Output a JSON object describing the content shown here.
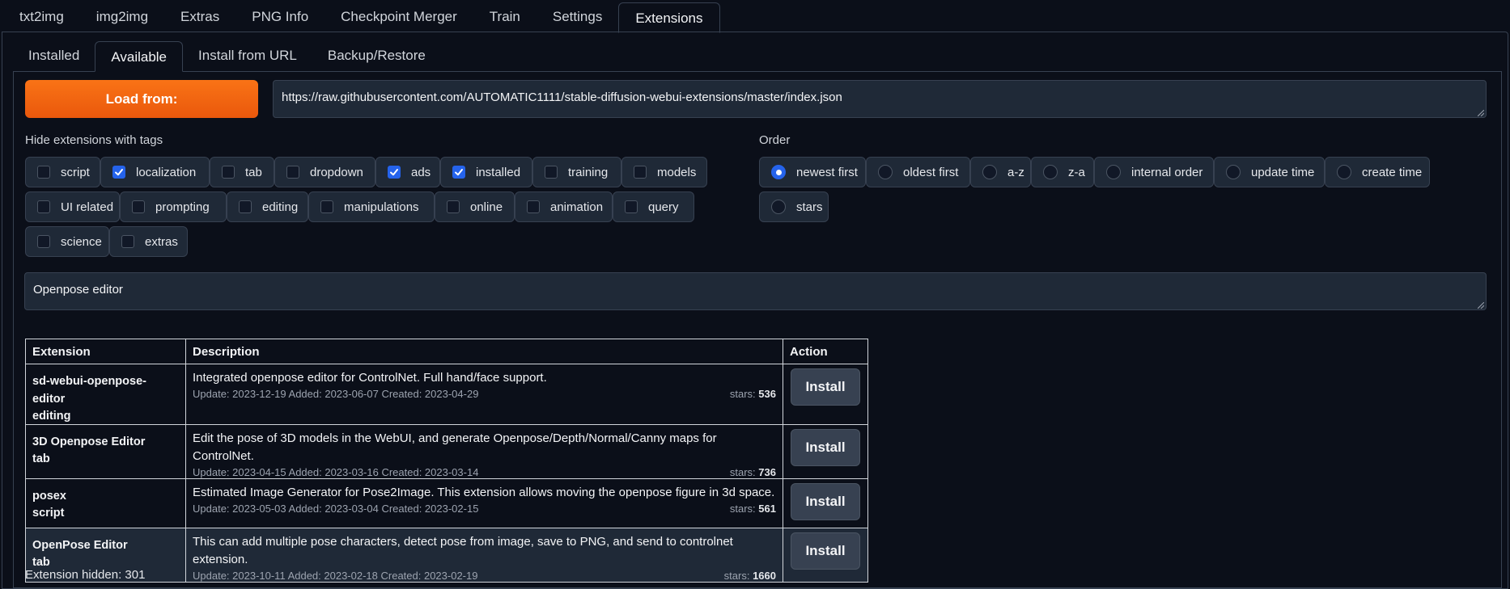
{
  "top_tabs": [
    "txt2img",
    "img2img",
    "Extras",
    "PNG Info",
    "Checkpoint Merger",
    "Train",
    "Settings",
    "Extensions"
  ],
  "top_tab_active": "Extensions",
  "sub_tabs": [
    "Installed",
    "Available",
    "Install from URL",
    "Backup/Restore"
  ],
  "sub_tab_active": "Available",
  "load_button": "Load from:",
  "url_value": "https://raw.githubusercontent.com/AUTOMATIC1111/stable-diffusion-webui-extensions/master/index.json",
  "hide_tags_label": "Hide extensions with tags",
  "tags": [
    {
      "label": "script",
      "checked": false
    },
    {
      "label": "localization",
      "checked": true
    },
    {
      "label": "tab",
      "checked": false
    },
    {
      "label": "dropdown",
      "checked": false
    },
    {
      "label": "ads",
      "checked": true
    },
    {
      "label": "installed",
      "checked": true
    },
    {
      "label": "training",
      "checked": false
    },
    {
      "label": "models",
      "checked": false
    },
    {
      "label": "UI related",
      "checked": false
    },
    {
      "label": "prompting",
      "checked": false
    },
    {
      "label": "editing",
      "checked": false
    },
    {
      "label": "manipulations",
      "checked": false
    },
    {
      "label": "online",
      "checked": false
    },
    {
      "label": "animation",
      "checked": false
    },
    {
      "label": "query",
      "checked": false
    },
    {
      "label": "science",
      "checked": false
    },
    {
      "label": "extras",
      "checked": false
    }
  ],
  "order_label": "Order",
  "order_options": [
    {
      "label": "newest first",
      "selected": true
    },
    {
      "label": "oldest first",
      "selected": false
    },
    {
      "label": "a-z",
      "selected": false
    },
    {
      "label": "z-a",
      "selected": false
    },
    {
      "label": "internal order",
      "selected": false
    },
    {
      "label": "update time",
      "selected": false
    },
    {
      "label": "create time",
      "selected": false
    },
    {
      "label": "stars",
      "selected": false
    }
  ],
  "search_value": "Openpose editor",
  "table": {
    "headers": [
      "Extension",
      "Description",
      "Action"
    ],
    "stars_prefix": "stars: ",
    "rows": [
      {
        "name": "sd-webui-openpose-editor",
        "tag": "editing",
        "description": "Integrated openpose editor for ControlNet. Full hand/face support.",
        "dates": "Update: 2023-12-19 Added: 2023-06-07 Created: 2023-04-29",
        "stars": "536",
        "action": "Install"
      },
      {
        "name": "3D Openpose Editor",
        "tag": "tab",
        "description": "Edit the pose of 3D models in the WebUI, and generate Openpose/Depth/Normal/Canny maps for ControlNet.",
        "dates": "Update: 2023-04-15 Added: 2023-03-16 Created: 2023-03-14",
        "stars": "736",
        "action": "Install"
      },
      {
        "name": "posex",
        "tag": "script",
        "description": "Estimated Image Generator for Pose2Image. This extension allows moving the openpose figure in 3d space.",
        "dates": "Update: 2023-05-03 Added: 2023-03-04 Created: 2023-02-15",
        "stars": "561",
        "action": "Install"
      },
      {
        "name": "OpenPose Editor",
        "tag": "tab",
        "description": "This can add multiple pose characters, detect pose from image, save to PNG, and send to controlnet extension.",
        "dates": "Update: 2023-10-11 Added: 2023-02-18 Created: 2023-02-19",
        "stars": "1660",
        "action": "Install"
      }
    ]
  },
  "hidden_count": "Extension hidden: 301",
  "colors": {
    "accent": "#f97316",
    "checkbox": "#2563eb",
    "background": "#0b0f19",
    "field": "#1f2937"
  }
}
